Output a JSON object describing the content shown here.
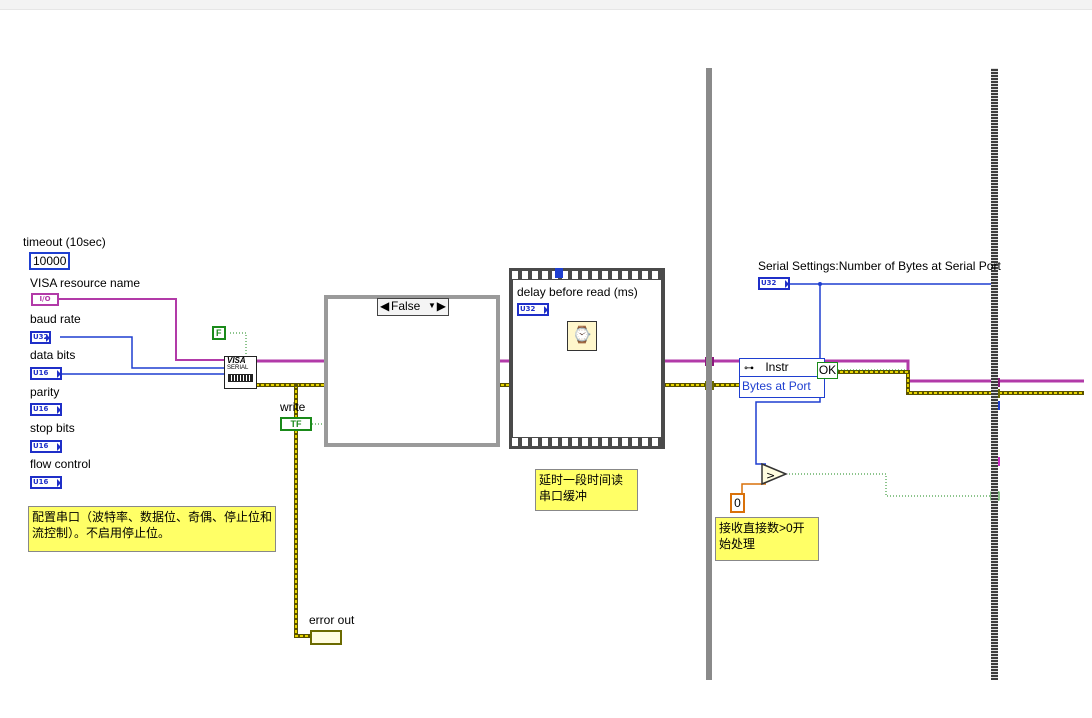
{
  "controls": {
    "timeout_label": "timeout (10sec)",
    "timeout_value": "10000",
    "visa_label": "VISA resource name",
    "visa_terminal": "I/O",
    "baud_label": "baud rate",
    "baud_terminal": "U32",
    "databits_label": "data bits",
    "databits_terminal": "U16",
    "parity_label": "parity",
    "parity_terminal": "U16",
    "stopbits_label": "stop bits",
    "stopbits_terminal": "U16",
    "flow_label": "flow control",
    "flow_terminal": "U16"
  },
  "false_constant": "F",
  "visa_node": {
    "line1": "VISA",
    "line2": "SERIAL"
  },
  "write": {
    "label": "write",
    "terminal": "TF"
  },
  "error_out_label": "error out",
  "note_config": "配置串口（波特率、数据位、奇偶、停止位和流控制）。不启用停止位。",
  "case_structure": {
    "selector": "False"
  },
  "sequence": {
    "delay_label": "delay before read (ms)",
    "delay_terminal": "U32"
  },
  "note_delay": "延时一段时间读串口缓冲",
  "property_node": {
    "header": "Instr",
    "property": "Bytes at Port"
  },
  "ok_label": "OK",
  "serial_settings_label": "Serial Settings:Number of Bytes at Serial Port",
  "serial_settings_terminal": "U32",
  "zero_constant": "0",
  "note_receive": "接收直接数>0开始处理",
  "colors": {
    "visa_wire": "#b23aa8",
    "error_wire": "#c8b400",
    "numeric_wire": "#1f3fd0",
    "boolean_wire": "#1a8a1a"
  }
}
